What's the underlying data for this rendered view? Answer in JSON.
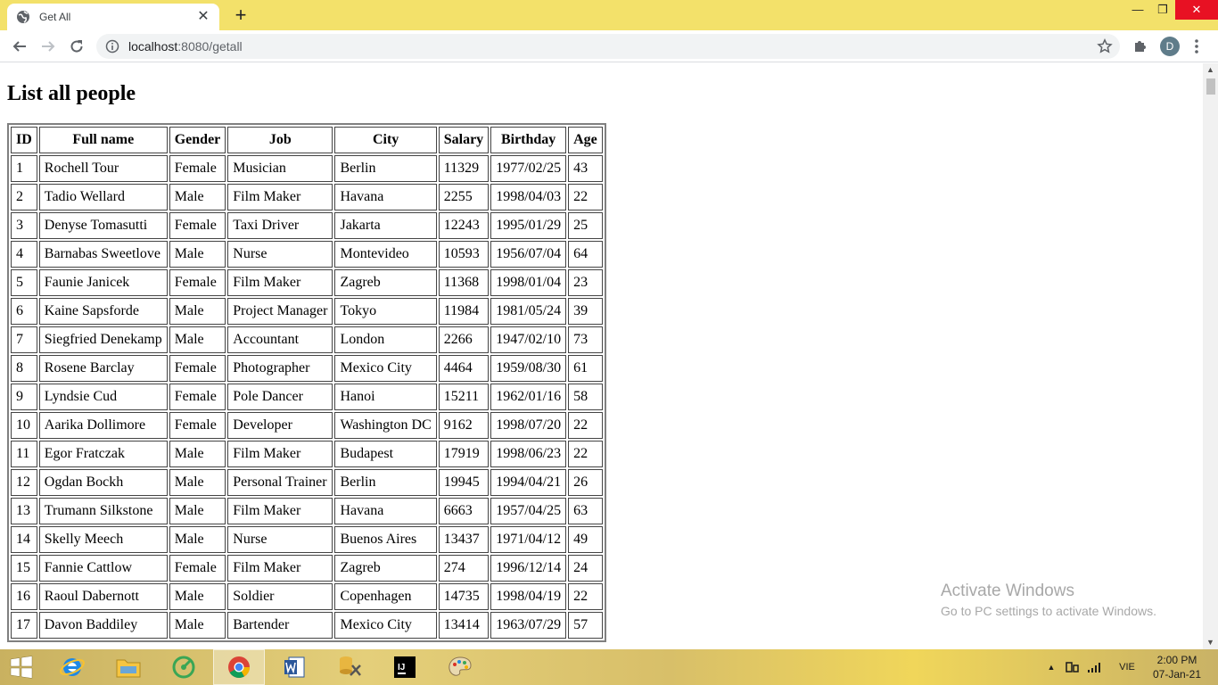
{
  "browser": {
    "tab_title": "Get All",
    "url_host": "localhost",
    "url_rest": ":8080/getall",
    "profile_initial": "D"
  },
  "page": {
    "title": "List all people",
    "columns": [
      "ID",
      "Full name",
      "Gender",
      "Job",
      "City",
      "Salary",
      "Birthday",
      "Age"
    ],
    "rows": [
      [
        "1",
        "Rochell Tour",
        "Female",
        "Musician",
        "Berlin",
        "11329",
        "1977/02/25",
        "43"
      ],
      [
        "2",
        "Tadio Wellard",
        "Male",
        "Film Maker",
        "Havana",
        "2255",
        "1998/04/03",
        "22"
      ],
      [
        "3",
        "Denyse Tomasutti",
        "Female",
        "Taxi Driver",
        "Jakarta",
        "12243",
        "1995/01/29",
        "25"
      ],
      [
        "4",
        "Barnabas Sweetlove",
        "Male",
        "Nurse",
        "Montevideo",
        "10593",
        "1956/07/04",
        "64"
      ],
      [
        "5",
        "Faunie Janicek",
        "Female",
        "Film Maker",
        "Zagreb",
        "11368",
        "1998/01/04",
        "23"
      ],
      [
        "6",
        "Kaine Sapsforde",
        "Male",
        "Project Manager",
        "Tokyo",
        "11984",
        "1981/05/24",
        "39"
      ],
      [
        "7",
        "Siegfried Denekamp",
        "Male",
        "Accountant",
        "London",
        "2266",
        "1947/02/10",
        "73"
      ],
      [
        "8",
        "Rosene Barclay",
        "Female",
        "Photographer",
        "Mexico City",
        "4464",
        "1959/08/30",
        "61"
      ],
      [
        "9",
        "Lyndsie Cud",
        "Female",
        "Pole Dancer",
        "Hanoi",
        "15211",
        "1962/01/16",
        "58"
      ],
      [
        "10",
        "Aarika Dollimore",
        "Female",
        "Developer",
        "Washington DC",
        "9162",
        "1998/07/20",
        "22"
      ],
      [
        "11",
        "Egor Fratczak",
        "Male",
        "Film Maker",
        "Budapest",
        "17919",
        "1998/06/23",
        "22"
      ],
      [
        "12",
        "Ogdan Bockh",
        "Male",
        "Personal Trainer",
        "Berlin",
        "19945",
        "1994/04/21",
        "26"
      ],
      [
        "13",
        "Trumann Silkstone",
        "Male",
        "Film Maker",
        "Havana",
        "6663",
        "1957/04/25",
        "63"
      ],
      [
        "14",
        "Skelly Meech",
        "Male",
        "Nurse",
        "Buenos Aires",
        "13437",
        "1971/04/12",
        "49"
      ],
      [
        "15",
        "Fannie Cattlow",
        "Female",
        "Film Maker",
        "Zagreb",
        "274",
        "1996/12/14",
        "24"
      ],
      [
        "16",
        "Raoul Dabernott",
        "Male",
        "Soldier",
        "Copenhagen",
        "14735",
        "1998/04/19",
        "22"
      ],
      [
        "17",
        "Davon Baddiley",
        "Male",
        "Bartender",
        "Mexico City",
        "13414",
        "1963/07/29",
        "57"
      ]
    ]
  },
  "watermark": {
    "line1": "Activate Windows",
    "line2": "Go to PC settings to activate Windows."
  },
  "taskbar": {
    "language": "VIE",
    "time": "2:00 PM",
    "date": "07-Jan-21"
  },
  "icons": {
    "favicon": "globe-icon",
    "back": "arrow-left-icon",
    "forward": "arrow-right-icon",
    "reload": "reload-icon",
    "site_info": "info-icon",
    "bookmark": "star-icon",
    "extensions": "puzzle-icon",
    "menu": "more-vert-icon"
  },
  "colors": {
    "titlebar": "#f3e16a",
    "close_button": "#e81123",
    "avatar": "#5f7c8a"
  }
}
